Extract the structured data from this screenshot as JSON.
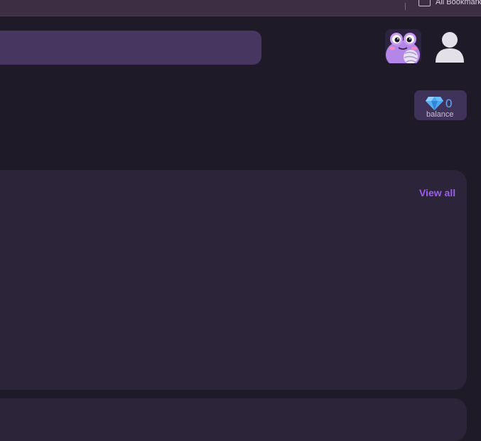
{
  "bookmarks_bar": {
    "all_bookmarks_label": "All Bookmarks",
    "folder_icon": "folder-icon"
  },
  "header": {
    "search_icon": "search-icon",
    "avatar_icon": "frog-avatar-icon",
    "user_icon": "user-icon"
  },
  "balance": {
    "value": "0",
    "label": "balance",
    "icon": "gem-icon"
  },
  "panel": {
    "view_all_label": "View all"
  },
  "colors": {
    "background": "#1f1a28",
    "panel": "#2c2438",
    "search": "#463660",
    "accent": "#9b5ef0",
    "balance_value": "#6aa8ef"
  }
}
